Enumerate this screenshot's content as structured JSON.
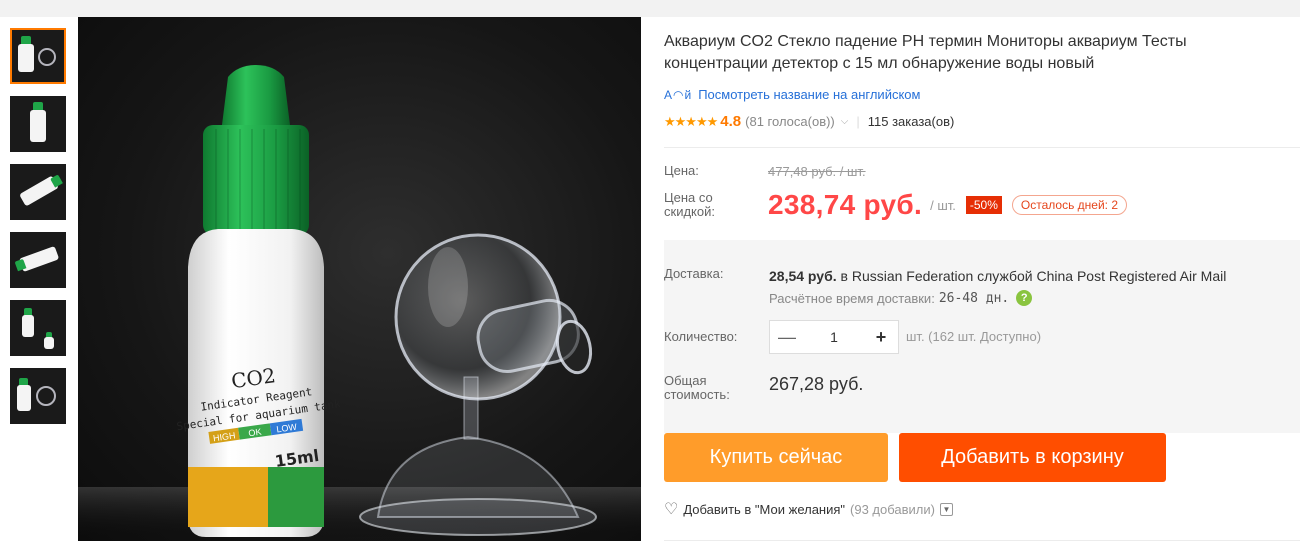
{
  "product": {
    "title": "Аквариум CO2 Стекло падение PH термин Мониторы аквариум Тесты концентрации детектор с 15 мл обнаружение воды новый",
    "translate_link": "Посмотреть название на английском",
    "translate_icon": "translate-icon",
    "rating": {
      "stars_text": "★★★★★",
      "value": "4.8",
      "votes": "(81 голоса(ов))",
      "orders": "115 заказа(ов)"
    }
  },
  "price": {
    "label": "Цена:",
    "original": "477,48 руб. / шт.",
    "discount_label": "Цена со скидкой:",
    "discounted": "238,74 руб.",
    "unit": "/ шт.",
    "discount_badge": "-50%",
    "days_left": "Осталось дней: 2"
  },
  "shipping": {
    "label": "Доставка:",
    "cost": "28,54 руб.",
    "text": " в Russian Federation службой China Post Registered Air Mail",
    "estimate_label": "Расчётное время доставки:",
    "estimate_days": "26-48 дн."
  },
  "quantity": {
    "label": "Количество:",
    "minus": "—",
    "value": "1",
    "plus": "+",
    "available": "шт. (162 шт. Доступно)"
  },
  "total": {
    "label": "Общая стоимость:",
    "value": "267,28 руб."
  },
  "actions": {
    "buy_now": "Купить сейчас",
    "add_to_cart": "Добавить в корзину"
  },
  "wishlist": {
    "label": "Добавить в \"Мои желания\"",
    "count": "(93 добавили)"
  },
  "image": {
    "label_co2": "CO2",
    "label_line1": "Indicator Reagent",
    "label_line2": "Special for aquarium tank",
    "label_scale": [
      "HIGH",
      "OK",
      "LOW"
    ],
    "label_volume": "15ml"
  },
  "colors": {
    "accent_orange": "#ff9c2a",
    "cart_red": "#ff4e00",
    "price_red": "#ff4747",
    "link_blue": "#2670d8",
    "selected_thumb": "#ff7a00",
    "cap_green": "#1fa548"
  }
}
